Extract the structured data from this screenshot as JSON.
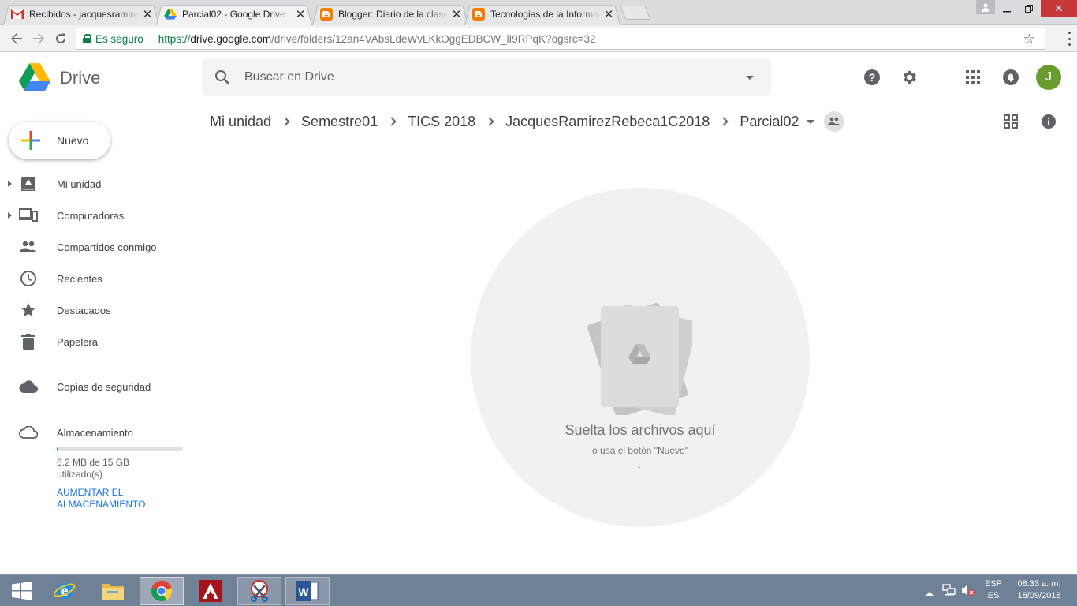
{
  "browser": {
    "tabs": [
      {
        "title": "Recibidos - jacquesramirez",
        "icon": "gmail-icon"
      },
      {
        "title": "Parcial02 - Google Drive",
        "icon": "drive-icon"
      },
      {
        "title": "Blogger: Diario de la clase",
        "icon": "blogger-icon"
      },
      {
        "title": "Tecnologias de la Informacion",
        "icon": "blogger-icon"
      }
    ],
    "active_tab": 1,
    "secure_label": "Es seguro",
    "url_proto": "https://",
    "url_host": "drive.google.com",
    "url_path": "/drive/folders/12an4VAbsLdeWvLKkOggEDBCW_iI9RPqK?ogsrc=32"
  },
  "drive": {
    "brand": "Drive",
    "search_placeholder": "Buscar en Drive",
    "avatar_initial": "J",
    "breadcrumbs": [
      "Mi unidad",
      "Semestre01",
      "TICS 2018",
      "JacquesRamirezRebeca1C2018",
      "Parcial02"
    ],
    "new_button": "Nuevo",
    "nav": [
      {
        "label": "Mi unidad",
        "icon": "my-drive-icon"
      },
      {
        "label": "Computadoras",
        "icon": "computers-icon"
      },
      {
        "label": "Compartidos conmigo",
        "icon": "shared-with-me-icon"
      },
      {
        "label": "Recientes",
        "icon": "recent-clock-icon"
      },
      {
        "label": "Destacados",
        "icon": "star-icon"
      },
      {
        "label": "Papelera",
        "icon": "trash-icon"
      }
    ],
    "backups_label": "Copias de seguridad",
    "storage_label": "Almacenamiento",
    "storage_used_text": "6.2 MB de 15 GB utilizado(s)",
    "storage_used_fraction": 0.0004,
    "upgrade_label": "Aumentar el almacenamiento",
    "empty_title": "Suelta los archivos aquí",
    "empty_subtitle": "o usa el botón \"Nuevo\"",
    "empty_dot": "."
  },
  "taskbar": {
    "lang_top": "ESP",
    "lang_bottom": "ES",
    "time": "08:33 a. m.",
    "date": "18/09/2018"
  },
  "colors": {
    "accent_blue": "#1a73e8",
    "avatar_green": "#6a9b2e",
    "taskbar": "#6f8197"
  }
}
